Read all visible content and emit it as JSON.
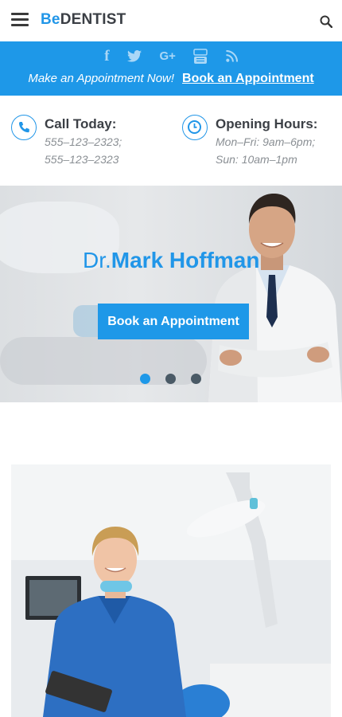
{
  "header": {
    "logo_be": "Be",
    "logo_rest": "DENTIST",
    "menu_icon": "hamburger-menu-icon",
    "search_icon": "search-icon"
  },
  "topbar": {
    "socials": [
      {
        "name": "facebook-icon",
        "glyph": "f"
      },
      {
        "name": "twitter-icon",
        "glyph": ""
      },
      {
        "name": "google-plus-icon",
        "glyph": "G+"
      },
      {
        "name": "youtube-icon",
        "glyph": ""
      },
      {
        "name": "rss-icon",
        "glyph": ""
      }
    ],
    "make_text": "Make an Appointment Now!",
    "book_link": "Book an Appointment"
  },
  "info": {
    "call": {
      "title": "Call Today:",
      "lines": [
        "555–123–2323;",
        "555–123–2323"
      ],
      "icon": "phone-icon"
    },
    "hours": {
      "title": "Opening Hours:",
      "lines": [
        "Mon–Fri: 9am–6pm;",
        "Sun: 10am–1pm"
      ],
      "icon": "clock-icon"
    }
  },
  "hero": {
    "dr_prefix": "Dr.",
    "doctor_name": "Mark Hoffman",
    "button_label": "Book an Appointment",
    "slides_total": 3,
    "active_slide": 1
  },
  "colors": {
    "accent": "#1e98e8",
    "dark": "#3b3f45",
    "dot_inactive": "#4a5a66"
  }
}
